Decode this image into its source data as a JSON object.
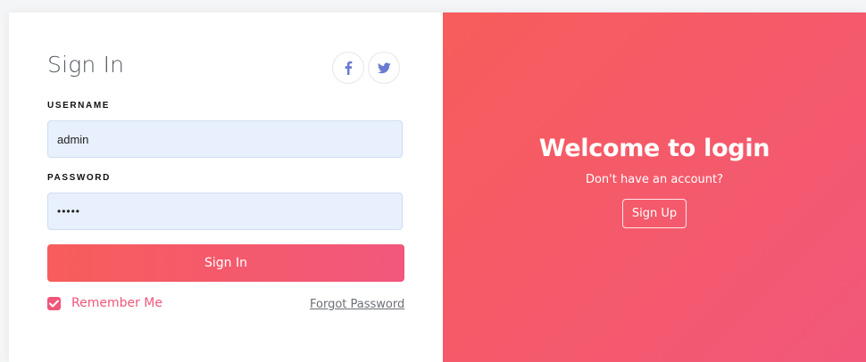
{
  "login": {
    "title": "Sign In",
    "username_label": "USERNAME",
    "username_value": "admin",
    "password_label": "PASSWORD",
    "password_value": "•••••",
    "signin_label": "Sign In",
    "remember_label": "Remember Me",
    "remember_checked": true,
    "forgot_label": "Forgot Password",
    "social": [
      "facebook-icon",
      "twitter-icon"
    ]
  },
  "welcome": {
    "heading": "Welcome to login",
    "subtitle": "Don't have an account?",
    "signup_label": "Sign Up"
  },
  "colors": {
    "accent": "#f2577a",
    "gradient_start": "#f75d5b",
    "gradient_end": "#f2577d",
    "field_bg": "#e8f0fd"
  }
}
